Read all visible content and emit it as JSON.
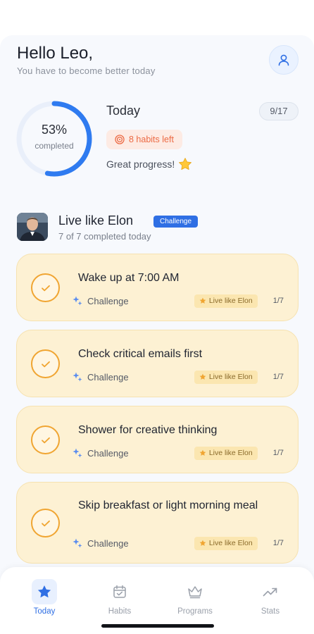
{
  "header": {
    "greeting": "Hello Leo,",
    "subtitle": "You have to become better today"
  },
  "summary": {
    "percent": "53%",
    "percent_value": 0.53,
    "completed_label": "completed",
    "title": "Today",
    "count": "9/17",
    "habits_left": "8 habits left",
    "message": "Great progress!"
  },
  "challenge": {
    "title": "Live like Elon",
    "tag": "Challenge",
    "subtitle": "7 of 7 completed today"
  },
  "habits": [
    {
      "title": "Wake up at 7:00 AM",
      "type": "Challenge",
      "chip": "Live like Elon",
      "progress": "1/7"
    },
    {
      "title": "Check critical emails first",
      "type": "Challenge",
      "chip": "Live like Elon",
      "progress": "1/7"
    },
    {
      "title": "Shower for creative thinking",
      "type": "Challenge",
      "chip": "Live like Elon",
      "progress": "1/7"
    },
    {
      "title": "Skip breakfast or light morning meal",
      "type": "Challenge",
      "chip": "Live like Elon",
      "progress": "1/7"
    }
  ],
  "nav": {
    "today": "Today",
    "habits": "Habits",
    "programs": "Programs",
    "stats": "Stats"
  },
  "colors": {
    "accent": "#2f6fe4",
    "card_bg": "#fdf1d3",
    "check": "#f0a532",
    "warning_text": "#ec6a44"
  },
  "icons": [
    "user-icon",
    "target-icon",
    "star-emoji-icon",
    "sparkle-icon",
    "star-icon",
    "checkmark-icon",
    "calendar-icon",
    "crown-icon",
    "trend-icon"
  ]
}
